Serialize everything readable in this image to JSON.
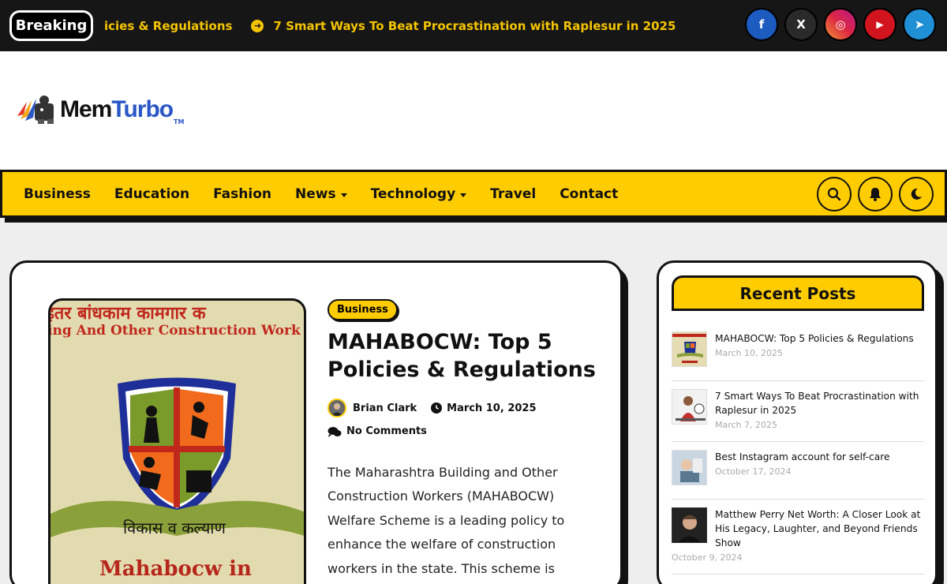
{
  "topbar": {
    "breaking_label": "Breaking",
    "ticker_items": [
      "icies & Regulations",
      "7 Smart Ways To Beat Procrastination with Raplesur in 2025"
    ],
    "socials": [
      {
        "icon": "facebook-icon",
        "glyph": "f",
        "color": "#1c5bbf"
      },
      {
        "icon": "x-icon",
        "glyph": "X",
        "color": "#2a2a2a"
      },
      {
        "icon": "instagram-icon",
        "glyph": "◎",
        "color": "#c7337a"
      },
      {
        "icon": "youtube-icon",
        "glyph": "▶",
        "color": "#d2141e"
      },
      {
        "icon": "telegram-icon",
        "glyph": "➤",
        "color": "#1f8fd6"
      }
    ]
  },
  "logo": {
    "mem": "Mem",
    "turbo": "Turbo",
    "tm": "TM"
  },
  "nav": {
    "items": [
      {
        "label": "Business",
        "dropdown": false
      },
      {
        "label": "Education",
        "dropdown": false
      },
      {
        "label": "Fashion",
        "dropdown": false
      },
      {
        "label": "News",
        "dropdown": true
      },
      {
        "label": "Technology",
        "dropdown": true
      },
      {
        "label": "Travel",
        "dropdown": false
      },
      {
        "label": "Contact",
        "dropdown": false
      }
    ]
  },
  "post": {
    "image_text_top": "इतर बांधकाम कामगार क",
    "image_text_sub": "ing And Other Construction Work",
    "image_ribbon": "विकास व कल्याण",
    "image_text_bottom": "Mahabocw in",
    "category": "Business",
    "title": "MAHABOCW: Top 5 Policies & Regulations",
    "author": "Brian Clark",
    "date": "March 10, 2025",
    "comments": "No Comments",
    "excerpt": "The Maharashtra Building and Other Construction Workers (MAHABOCW) Welfare Scheme is a leading policy to enhance the welfare of construction workers in the state. This scheme is"
  },
  "sidebar": {
    "title": "Recent Posts",
    "posts": [
      {
        "title": "MAHABOCW: Top 5 Policies & Regulations",
        "date": "March 10, 2025"
      },
      {
        "title": "7 Smart Ways To Beat Procrastination with Raplesur in 2025",
        "date": "March 7, 2025"
      },
      {
        "title": "Best Instagram account for self-care",
        "date": "October 17, 2024"
      },
      {
        "title": "Matthew Perry Net Worth: A Closer Look at His Legacy, Laughter, and Beyond Friends Show",
        "date": "October 9, 2024"
      }
    ]
  },
  "colors": {
    "accent": "#ffcc00",
    "dark": "#161616",
    "link_blue": "#2a56c6"
  }
}
